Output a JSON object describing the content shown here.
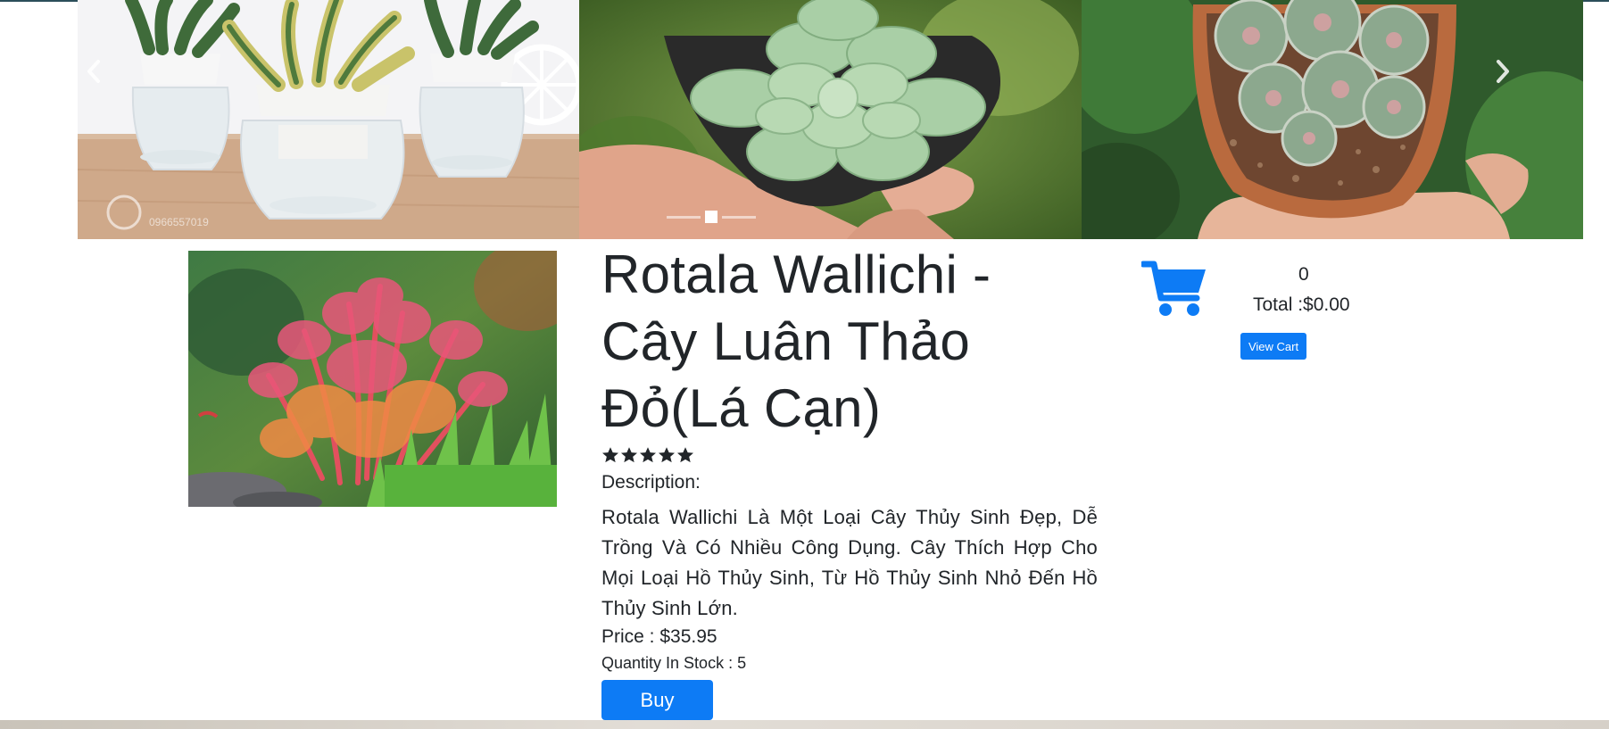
{
  "carousel": {
    "slides": [
      {
        "alt": "snake plants in glass pots",
        "watermark": "0966557019"
      },
      {
        "alt": "succulent in hand"
      },
      {
        "alt": "cactus in terracotta pot"
      }
    ],
    "active_index": 1,
    "prev_icon": "chevron-left-icon",
    "next_icon": "chevron-right-icon"
  },
  "product": {
    "title": "Rotala Wallichi - Cây Luân Thảo Đỏ(Lá Cạn)",
    "rating": 5,
    "rating_max": 5,
    "description_label": "Description:",
    "description": "Rotala Wallichi Là Một Loại Cây Thủy Sinh Đẹp, Dễ Trồng Và Có Nhiều Công Dụng. Cây Thích Hợp Cho Mọi Loại Hồ Thủy Sinh, Từ Hồ Thủy Sinh Nhỏ Đến Hồ Thủy Sinh Lớn.",
    "price_text": "Price : $35.95",
    "stock_text": "Quantity In Stock : 5",
    "buy_label": "Buy"
  },
  "cart": {
    "icon": "shopping-cart-icon",
    "count": "0",
    "total_text": "Total :$0.00",
    "view_cart_label": "View Cart"
  },
  "colors": {
    "accent": "#0d7bf5",
    "text": "#212529"
  }
}
